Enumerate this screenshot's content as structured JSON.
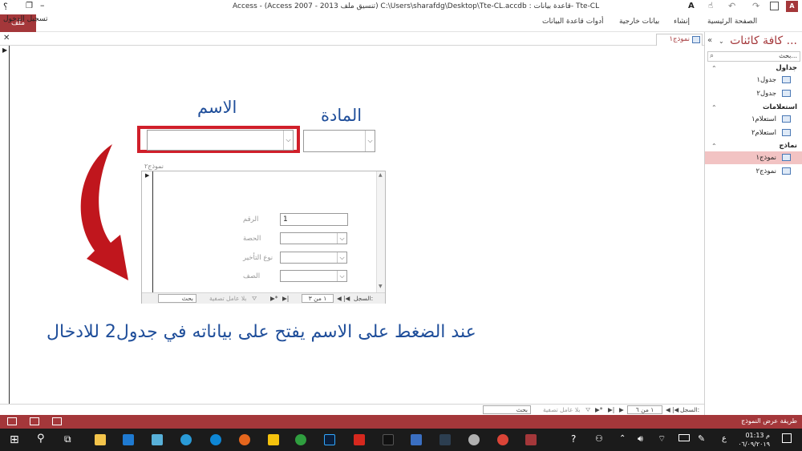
{
  "window": {
    "title": "Access - (Access 2007 - 2013 تنسيق ملف) C:\\Users\\sharafdg\\Desktop\\Tte-CL.accdb : قاعدة بيانات- Tte-CL",
    "help": "؟",
    "sign_in": "تسجيل الدخول",
    "font_icon": "A"
  },
  "ribbon": {
    "file": "ملف",
    "tabs": [
      "الصفحة الرئيسية",
      "إنشاء",
      "بيانات خارجية",
      "أدوات قاعدة البيانات"
    ]
  },
  "nav_pane": {
    "title": "كافة كائنات ...",
    "search_placeholder": "بحث...",
    "groups": [
      {
        "label": "جداول",
        "items": [
          "جدول١",
          "جدول٢"
        ]
      },
      {
        "label": "استعلامات",
        "items": [
          "استعلام١",
          "استعلام٢"
        ]
      },
      {
        "label": "نماذج",
        "items": [
          "نموذج١",
          "نموذج٢"
        ]
      }
    ]
  },
  "document": {
    "tab_label": "نموذج١",
    "label_subject": "المادة",
    "label_name": "الاسم",
    "subform_caption": "نموذج٢",
    "fields": [
      {
        "label": "الرقم",
        "value": "1"
      },
      {
        "label": "الحصة",
        "value": ""
      },
      {
        "label": "نوع التأخير",
        "value": ""
      },
      {
        "label": "الصف",
        "value": ""
      }
    ],
    "instruction": "عند الضغط على الاسم يفتح على بياناته في جدول2 للادخال"
  },
  "subform_nav": {
    "record_label": "السجل:",
    "position": "١ من ٣",
    "filter": "بلا عامل تصفية",
    "search": "بحث"
  },
  "main_nav": {
    "record_label": "السجل:",
    "position": "١ من ٦",
    "filter": "بلا عامل تصفية",
    "search": "بحث"
  },
  "status": {
    "view": "طريقة عرض النموذج"
  },
  "taskbar": {
    "time": "01:13 م",
    "date": "٠٦/٠٩/٢٠١٩",
    "lang": "ع"
  },
  "colors": {
    "accent": "#a4373a",
    "label_blue": "#1f4e9a",
    "highlight_red": "#d01f2a",
    "arrow_red": "#c0161d"
  }
}
